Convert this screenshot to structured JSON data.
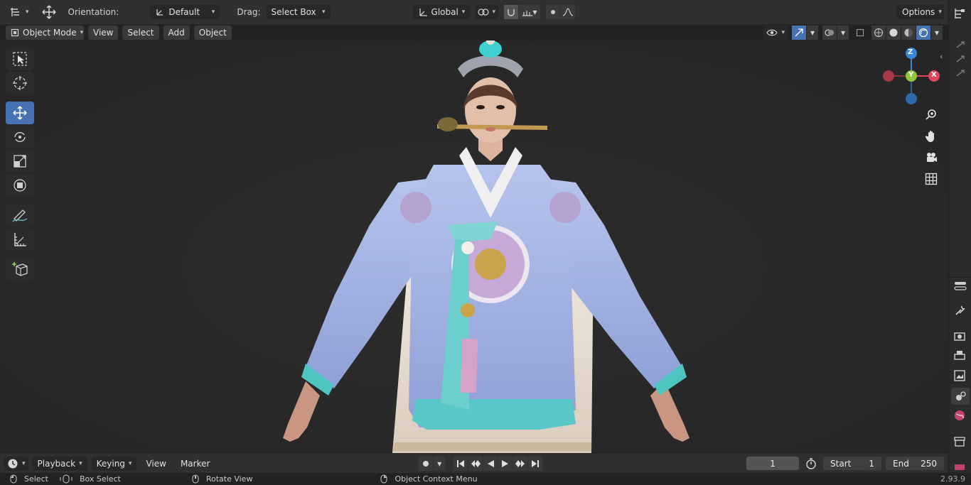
{
  "header": {
    "orientation_label": "Orientation:",
    "orientation_value": "Default",
    "drag_label": "Drag:",
    "drag_value": "Select Box",
    "transform_space": "Global",
    "options_label": "Options"
  },
  "viewport_header": {
    "mode": "Object Mode",
    "menus": [
      "View",
      "Select",
      "Add",
      "Object"
    ]
  },
  "gizmo": {
    "z": "Z",
    "y": "Y",
    "x": "X"
  },
  "timeline": {
    "menus": [
      "Playback",
      "Keying",
      "View",
      "Marker"
    ],
    "current_frame": "1",
    "start_label": "Start",
    "start_value": "1",
    "end_label": "End",
    "end_value": "250"
  },
  "status": {
    "select": "Select",
    "box_select": "Box Select",
    "rotate_view": "Rotate View",
    "context_menu": "Object Context Menu",
    "version": "2.93.9"
  },
  "colors": {
    "accent": "#4772b3",
    "axis_x": "#e0455c",
    "axis_y": "#8ec93c",
    "axis_z": "#3b86d6",
    "robe": "#a9b9e6",
    "cuff": "#4fc5c2"
  }
}
